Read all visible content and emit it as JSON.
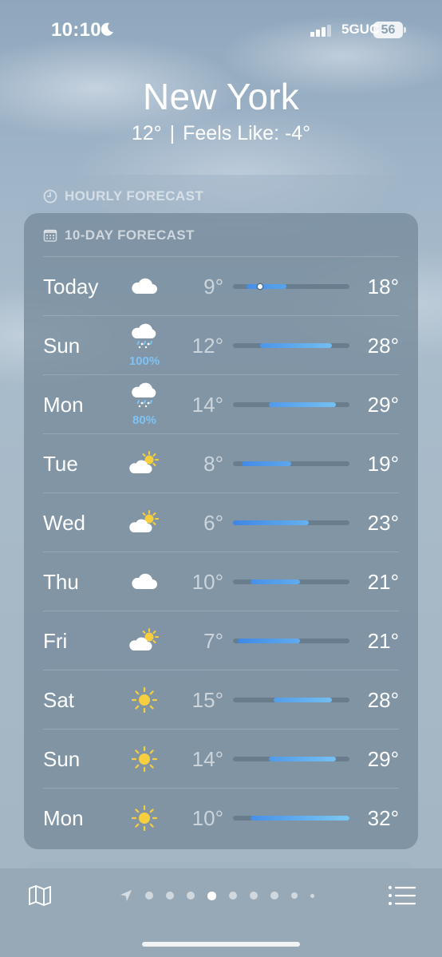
{
  "status_bar": {
    "time": "10:10",
    "network": "5GUC",
    "battery": "56"
  },
  "header": {
    "city": "New York",
    "current_temp": "12°",
    "separator": "|",
    "feels_like": "Feels Like: -4°"
  },
  "hourly": {
    "title": "HOURLY FORECAST"
  },
  "ten_day": {
    "title": "10-DAY FORECAST",
    "days": [
      {
        "day": "Today",
        "icon": "cloud-icon",
        "precip": "",
        "low": "9°",
        "high": "18°",
        "low_value": 9,
        "high_value": 18,
        "current_value": 12
      },
      {
        "day": "Sun",
        "icon": "sleet-icon",
        "precip": "100%",
        "low": "12°",
        "high": "28°",
        "low_value": 12,
        "high_value": 28
      },
      {
        "day": "Mon",
        "icon": "sleet-icon",
        "precip": "80%",
        "low": "14°",
        "high": "29°",
        "low_value": 14,
        "high_value": 29
      },
      {
        "day": "Tue",
        "icon": "partly-sunny-icon",
        "precip": "",
        "low": "8°",
        "high": "19°",
        "low_value": 8,
        "high_value": 19
      },
      {
        "day": "Wed",
        "icon": "partly-sunny-icon",
        "precip": "",
        "low": "6°",
        "high": "23°",
        "low_value": 6,
        "high_value": 23
      },
      {
        "day": "Thu",
        "icon": "cloud-icon",
        "precip": "",
        "low": "10°",
        "high": "21°",
        "low_value": 10,
        "high_value": 21
      },
      {
        "day": "Fri",
        "icon": "partly-sunny-icon",
        "precip": "",
        "low": "7°",
        "high": "21°",
        "low_value": 7,
        "high_value": 21
      },
      {
        "day": "Sat",
        "icon": "sun-icon",
        "precip": "",
        "low": "15°",
        "high": "28°",
        "low_value": 15,
        "high_value": 28
      },
      {
        "day": "Sun",
        "icon": "sun-icon",
        "precip": "",
        "low": "14°",
        "high": "29°",
        "low_value": 14,
        "high_value": 29
      },
      {
        "day": "Mon",
        "icon": "sun-icon",
        "precip": "",
        "low": "10°",
        "high": "32°",
        "low_value": 10,
        "high_value": 32
      }
    ],
    "range_min": 6,
    "range_max": 32
  },
  "colors": {
    "bar_cool": "#3d86e6",
    "bar_warm": "#5ab4ee",
    "precip": "#7ec3f4",
    "sun": "#f7cf3e"
  },
  "toolbar": {
    "map_icon": "map-icon",
    "list_icon": "list-icon",
    "page_count": 9,
    "active_page": 4
  }
}
